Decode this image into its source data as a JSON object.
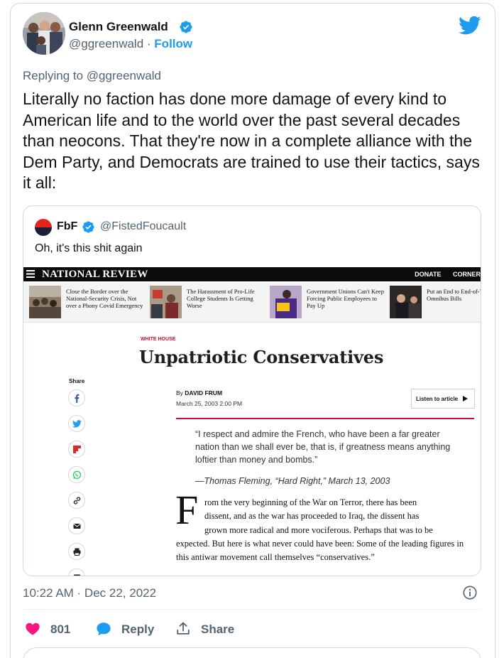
{
  "tweet": {
    "author": {
      "name": "Glenn Greenwald",
      "handle": "@ggreenwald",
      "separator": "·",
      "follow_label": "Follow"
    },
    "replying_prefix": "Replying to",
    "replying_to": "@ggreenwald",
    "text": "Literally no faction has done more damage of every kind to American life and to the world over the past several decades than neocons. That they're now in a complete alliance with the Dem Party, and Democrats are trained to use their tactics, says it all:",
    "timestamp": "10:22 AM · Dec 22, 2022",
    "likes": "801",
    "reply_label": "Reply",
    "share_label": "Share"
  },
  "quote": {
    "name": "FbF",
    "handle": "@FistedFoucault",
    "text": "Oh, it's this shit again",
    "article": {
      "brand": "NATIONAL REVIEW",
      "nav_links": [
        "DONATE",
        "CORNER"
      ],
      "strip": [
        {
          "title": "Close the Border over the National-Security Crisis, Not over a Phony Covid Emergency"
        },
        {
          "title": "The Harassment of Pro-Life College Students Is Getting Worse"
        },
        {
          "title": "Government Unions Can't Keep Forcing Public Employees to Pay Up"
        },
        {
          "title": "Put an End to End-of-Year Omnibus Bills"
        }
      ],
      "kicker": "WHITE HOUSE",
      "title": "Unpatriotic Conservatives",
      "share_label": "Share",
      "byline_prefix": "By",
      "author": "DAVID FRUM",
      "date": "March 25, 2003 2:00 PM",
      "listen_label": "Listen to article",
      "epigraph": "“I respect and admire the French, who have been a far greater nation than we shall ever be, that is, if greatness means anything loftier than money and bombs.”",
      "epigraph_attribution": "—Thomas Fleming, “Hard Right,” March 13, 2003",
      "drop_cap": "F",
      "body_first": "rom the very beginning of the War on Terror, there has been",
      "body_second": "dissent, and as the war has proceeded to Iraq, the dissent has",
      "body_third": "grown more radical and more vociferous. Perhaps that was to be",
      "body_rest": "expected. But here is what never could have been: Some of the leading figures in this antiwar movement call themselves “conservatives.”"
    }
  },
  "colors": {
    "accent": "#1d9bf0",
    "like": "#f91880",
    "muted": "#536471",
    "nr_red": "#c8102e"
  },
  "icons": [
    "verified-badge-icon",
    "twitter-bird-icon",
    "info-icon",
    "heart-icon",
    "reply-bubble-icon",
    "share-upload-icon",
    "hamburger-menu-icon",
    "facebook-icon",
    "twitter-icon",
    "flipboard-icon",
    "whatsapp-icon",
    "link-icon",
    "email-icon",
    "print-icon",
    "comment-icon",
    "play-icon"
  ]
}
